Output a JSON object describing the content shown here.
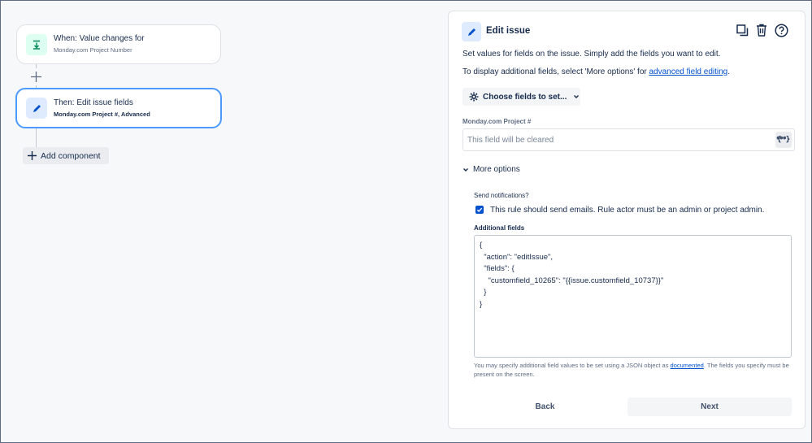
{
  "canvas": {
    "trigger": {
      "title": "When: Value changes for",
      "subtitle": "Monday.com Project Number",
      "icon": "download-arrow-icon"
    },
    "action": {
      "title": "Then: Edit issue fields",
      "subtitle": "Monday.com Project #, Advanced",
      "icon": "pencil-icon"
    },
    "add_component_label": "Add component"
  },
  "panel": {
    "title": "Edit issue",
    "description": "Set values for fields on the issue. Simply add the fields you want to edit.",
    "display_prefix": "To display additional fields, select 'More options' for",
    "display_link": "advanced field editing",
    "display_suffix": ".",
    "choose_fields_label": "Choose fields to set...",
    "field_label": "Monday.com Project #",
    "field_placeholder": "This field will be cleared",
    "braces_label": "{ }",
    "more_options_label": "More options",
    "send_notifications_label": "Send notifications?",
    "send_notifications_text": "This rule should send emails. Rule actor must be an admin or project admin.",
    "send_notifications_checked": true,
    "additional_fields_label": "Additional fields",
    "additional_fields_value": "{\n  \"action\": \"editIssue\",\n  \"fields\": {\n    \"customfield_10265\": \"{{issue.customfield_10737}}\"\n  }\n}",
    "help_prefix": "You may specify additional field values to be set using a JSON object as",
    "help_link": "documented",
    "help_suffix": ". The fields you specify must be present on the screen.",
    "back_label": "Back",
    "next_label": "Next"
  },
  "colors": {
    "accent": "#0052cc",
    "selected_border": "#4c9aff",
    "trigger_icon_bg": "#dcfff1",
    "action_icon_bg": "#deebff"
  }
}
